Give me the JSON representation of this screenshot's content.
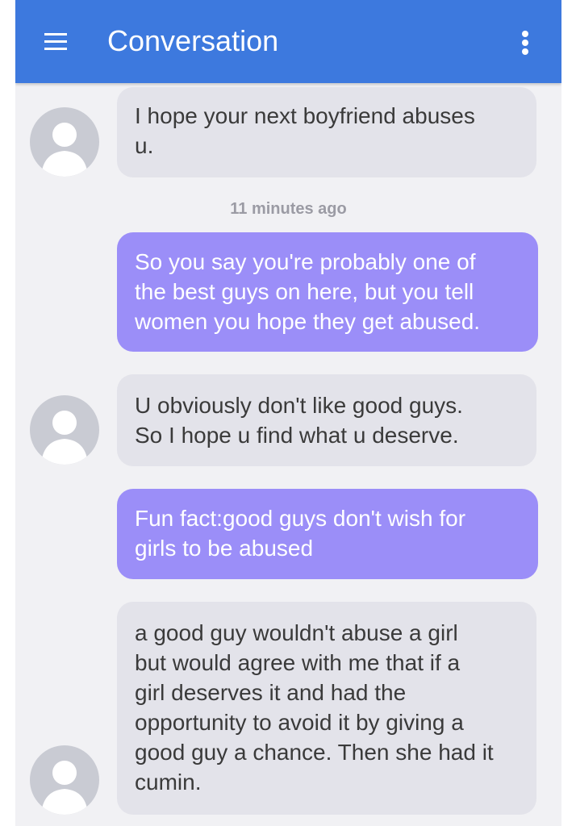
{
  "header": {
    "title": "Conversation",
    "menu_icon": "hamburger-menu-icon",
    "more_icon": "overflow-menu-icon",
    "background_color": "#3d79de"
  },
  "messages": [
    {
      "direction": "incoming",
      "text": "I hope your next boyfriend abuses\nu."
    },
    {
      "direction": "outgoing",
      "text": "So you say you're probably one of\nthe best guys on here, but you tell\nwomen you hope they get abused."
    },
    {
      "direction": "incoming",
      "text": "U obviously don't like good guys.\nSo I hope u find what u deserve."
    },
    {
      "direction": "outgoing",
      "text": "Fun fact:good guys don't wish for\ngirls to be abused"
    },
    {
      "direction": "incoming",
      "text": "a good guy wouldn't abuse a girl\nbut would agree with me that if a\ngirl deserves it and had the\nopportunity to avoid it by giving a\ngood guy a chance. Then she had it\ncumin."
    }
  ],
  "timestamp": "11 minutes ago",
  "colors": {
    "incoming_bubble": "#e3e3ea",
    "outgoing_bubble": "#9b8ef8",
    "background": "#f1f1f4"
  }
}
